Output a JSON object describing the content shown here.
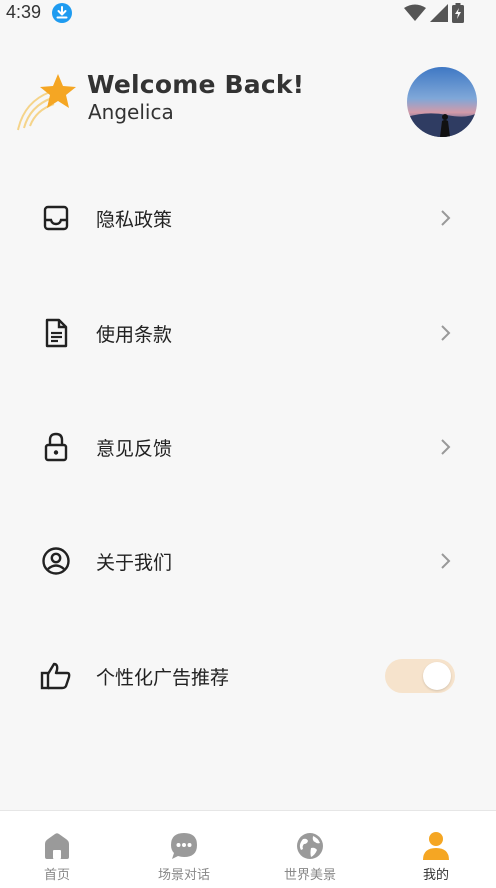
{
  "status_bar": {
    "time": "4:39",
    "icons": [
      "download-icon",
      "wifi-icon",
      "signal-icon",
      "battery-charging-icon"
    ]
  },
  "header": {
    "title": "Welcome Back!",
    "username": "Angelica",
    "logo_icon": "shooting-star-icon",
    "avatar": "user-avatar"
  },
  "menu": {
    "items": [
      {
        "label": "隐私政策",
        "icon": "inbox-icon",
        "control": "chevron"
      },
      {
        "label": "使用条款",
        "icon": "document-icon",
        "control": "chevron"
      },
      {
        "label": "意见反馈",
        "icon": "lock-icon",
        "control": "chevron"
      },
      {
        "label": "关于我们",
        "icon": "account-circle-icon",
        "control": "chevron"
      },
      {
        "label": "个性化广告推荐",
        "icon": "thumbs-up-icon",
        "control": "toggle",
        "toggle_on": true
      }
    ]
  },
  "tabbar": {
    "tabs": [
      {
        "label": "首页",
        "icon": "home-icon",
        "active": false
      },
      {
        "label": "场景对话",
        "icon": "chat-bubble-icon",
        "active": false
      },
      {
        "label": "世界美景",
        "icon": "globe-icon",
        "active": false
      },
      {
        "label": "我的",
        "icon": "person-icon",
        "active": true
      }
    ]
  },
  "colors": {
    "accent": "#f5a623",
    "toggle_track": "#f6e3cc",
    "inactive_icon": "#9a9a9a",
    "background": "#f7f7f7"
  }
}
